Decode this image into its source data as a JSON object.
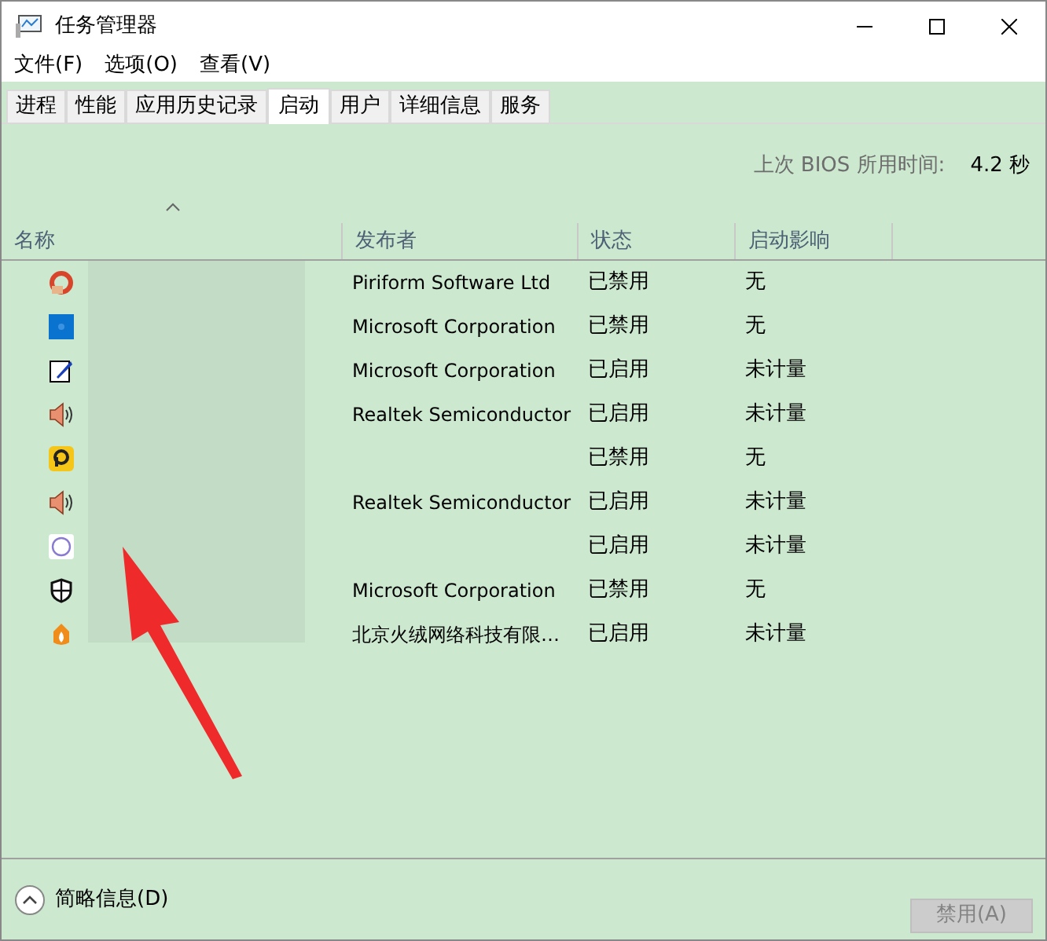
{
  "window": {
    "title": "任务管理器"
  },
  "menu": [
    "文件(F)",
    "选项(O)",
    "查看(V)"
  ],
  "tabs": [
    {
      "label": "进程",
      "selected": false
    },
    {
      "label": "性能",
      "selected": false
    },
    {
      "label": "应用历史记录",
      "selected": false
    },
    {
      "label": "启动",
      "selected": true
    },
    {
      "label": "用户",
      "selected": false
    },
    {
      "label": "详细信息",
      "selected": false
    },
    {
      "label": "服务",
      "selected": false
    }
  ],
  "bios": {
    "label": "上次 BIOS 所用时间:",
    "value": "4.2 秒"
  },
  "table": {
    "columns": [
      "名称",
      "发布者",
      "状态",
      "启动影响"
    ],
    "rows": [
      {
        "kind": "ccleaner",
        "publisher": "Piriform Software Ltd",
        "status": "已禁用",
        "impact": "无"
      },
      {
        "kind": "bluesquare",
        "publisher": "Microsoft Corporation",
        "status": "已禁用",
        "impact": "无"
      },
      {
        "kind": "notepad",
        "publisher": "Microsoft Corporation",
        "status": "已启用",
        "impact": "未计量"
      },
      {
        "kind": "speaker",
        "publisher": "Realtek Semiconductor",
        "status": "已启用",
        "impact": "未计量"
      },
      {
        "kind": "yellow",
        "publisher": "",
        "status": "已禁用",
        "impact": "无"
      },
      {
        "kind": "speaker",
        "publisher": "Realtek Semiconductor",
        "status": "已启用",
        "impact": "未计量"
      },
      {
        "kind": "circle",
        "publisher": "",
        "status": "已启用",
        "impact": "未计量"
      },
      {
        "kind": "shield",
        "publisher": "Microsoft Corporation",
        "status": "已禁用",
        "impact": "无"
      },
      {
        "kind": "flame",
        "publisher": "北京火绒网络科技有限…",
        "status": "已启用",
        "impact": "未计量"
      }
    ]
  },
  "footer": {
    "details": "简略信息(D)",
    "button": {
      "label": "禁用(A)",
      "disabled": true
    }
  }
}
